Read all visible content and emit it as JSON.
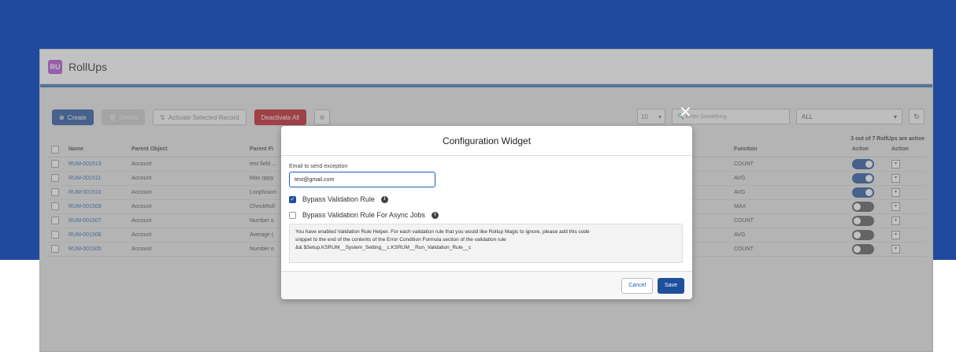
{
  "app": {
    "title": "RollUps",
    "logo_text": "RU"
  },
  "toolbar": {
    "create_label": "Create",
    "delete_label": "Delete",
    "activate_label": "Activate Selected Record",
    "deactivate_label": "Deactivate All",
    "page_size": "10",
    "search_placeholder": "Enter Something",
    "filter_value": "ALL"
  },
  "summary_text": "3 out of 7 RollUps are active",
  "table": {
    "columns": [
      "Name",
      "Parent Object",
      "Parent Fi",
      "Function",
      "Active",
      "Action"
    ],
    "rows": [
      {
        "name": "RUM-001513",
        "parent": "Account",
        "field": "test field ...",
        "function": "COUNT",
        "active": true
      },
      {
        "name": "RUM-001511",
        "parent": "Account",
        "field": "Max oppy",
        "function": "AVG",
        "active": true
      },
      {
        "name": "RUM-001510",
        "parent": "Account",
        "field": "Loopfusion",
        "function": "AVG",
        "active": true
      },
      {
        "name": "RUM-001509",
        "parent": "Account",
        "field": "CheckRoll",
        "function": "MAX",
        "active": false
      },
      {
        "name": "RUM-001507",
        "parent": "Account",
        "field": "Number o",
        "function": "COUNT",
        "active": false
      },
      {
        "name": "RUM-001506",
        "parent": "Account",
        "field": "Average (",
        "function": "AVG",
        "active": false
      },
      {
        "name": "RUM-001505",
        "parent": "Account",
        "field": "Number o",
        "function": "COUNT",
        "active": false
      }
    ]
  },
  "modal": {
    "title": "Configuration Widget",
    "email_label": "Email to send exception",
    "email_value": "test@gmail.com",
    "bypass_label": "Bypass Validation Rule",
    "bypass_async_label": "Bypass Validation Rule For Async Jobs",
    "info_line1": "You have enabled Validation Rule Helper. For each validation rule that you would like Rollup Magic to ignore, please add this code",
    "info_line2": "snippet to the end of the contents of the Error Condition Formula section of the validation rule",
    "info_line3": "&& $Setup.KSRUM__System_Setting__c.KSRUM__Run_Validation_Rule__c",
    "cancel_label": "Cancel",
    "save_label": "Save"
  },
  "colors": {
    "band": "#1f4a9e",
    "primary": "#1e4f9c",
    "danger": "#c0151f"
  }
}
